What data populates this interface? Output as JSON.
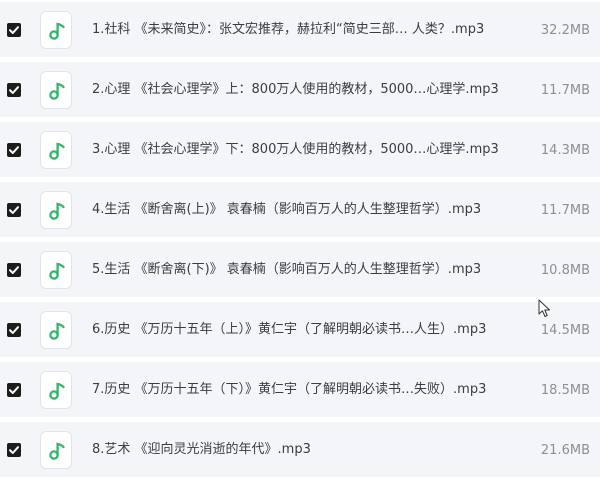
{
  "files": [
    {
      "name": "1.社科 《未来简史》：张文宏推荐，赫拉利“简史三部… 人类？.mp3",
      "size": "32.2MB",
      "checked": true
    },
    {
      "name": "2.心理 《社会心理学》上：800万人使用的教材，5000…心理学.mp3",
      "size": "11.7MB",
      "checked": true
    },
    {
      "name": "3.心理 《社会心理学》下：800万人使用的教材，5000…心理学.mp3",
      "size": "14.3MB",
      "checked": true
    },
    {
      "name": "4.生活 《断舍离(上)》 袁春楠（影响百万人的人生整理哲学）.mp3",
      "size": "11.7MB",
      "checked": true
    },
    {
      "name": "5.生活 《断舍离(下)》 袁春楠（影响百万人的人生整理哲学）.mp3",
      "size": "10.8MB",
      "checked": true
    },
    {
      "name": "6.历史 《万历十五年（上）》黄仁宇（了解明朝必读书…人生）.mp3",
      "size": "14.5MB",
      "checked": true
    },
    {
      "name": "7.历史 《万历十五年（下）》黄仁宇（了解明朝必读书…失败）.mp3",
      "size": "18.5MB",
      "checked": true
    },
    {
      "name": "8.艺术 《迎向灵光消逝的年代》.mp3",
      "size": "21.6MB",
      "checked": true
    }
  ],
  "icons": {
    "file_type": "music-note-icon",
    "checkbox": "check-icon",
    "cursor": "mouse-pointer-icon"
  },
  "colors": {
    "row_background": "#f4f5f9",
    "music_icon": "#2fb66b",
    "checkbox": "#1c1c1c",
    "text": "#3a3d45",
    "size_text": "#8b8f98"
  }
}
